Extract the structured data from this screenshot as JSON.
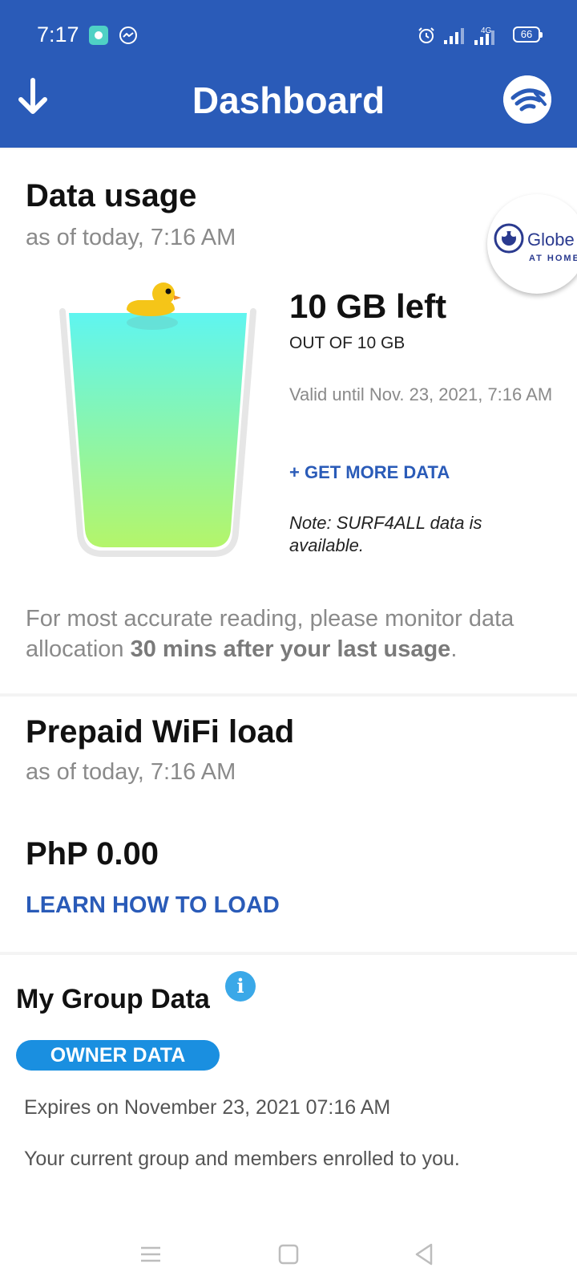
{
  "status_bar": {
    "time": "7:17",
    "battery": "66",
    "network": "4G"
  },
  "app_bar": {
    "title": "Dashboard",
    "back_icon": "arrow-down-icon",
    "logo_icon": "globe-wifi-logo-icon"
  },
  "data_usage": {
    "title": "Data usage",
    "subtitle": "as of today, 7:16 AM",
    "brand": {
      "name": "Globe",
      "sub": "AT HOME"
    },
    "left_label": "10 GB left",
    "total_label": "OUT OF 10 GB",
    "valid_until": "Valid until Nov. 23, 2021, 7:16 AM",
    "get_more_label": "+ GET MORE DATA",
    "note": "Note: SURF4ALL data is available.",
    "reading_prefix": "For most accurate reading, please monitor data allocation ",
    "reading_bold": "30 mins after your last usage",
    "reading_suffix": ".",
    "fill_fraction": 1.0
  },
  "prepaid": {
    "title": "Prepaid WiFi load",
    "subtitle": "as of today, 7:16 AM",
    "amount": "PhP 0.00",
    "learn_label": "LEARN HOW TO LOAD"
  },
  "group_data": {
    "title": "My Group Data",
    "info_glyph": "i",
    "owner_label": "OWNER DATA",
    "expires": "Expires on November 23, 2021 07:16 AM",
    "members": "Your current group and members enrolled to you."
  },
  "colors": {
    "primary": "#2a5bb8",
    "pill": "#1a8fe0",
    "info": "#3aa8e8"
  }
}
